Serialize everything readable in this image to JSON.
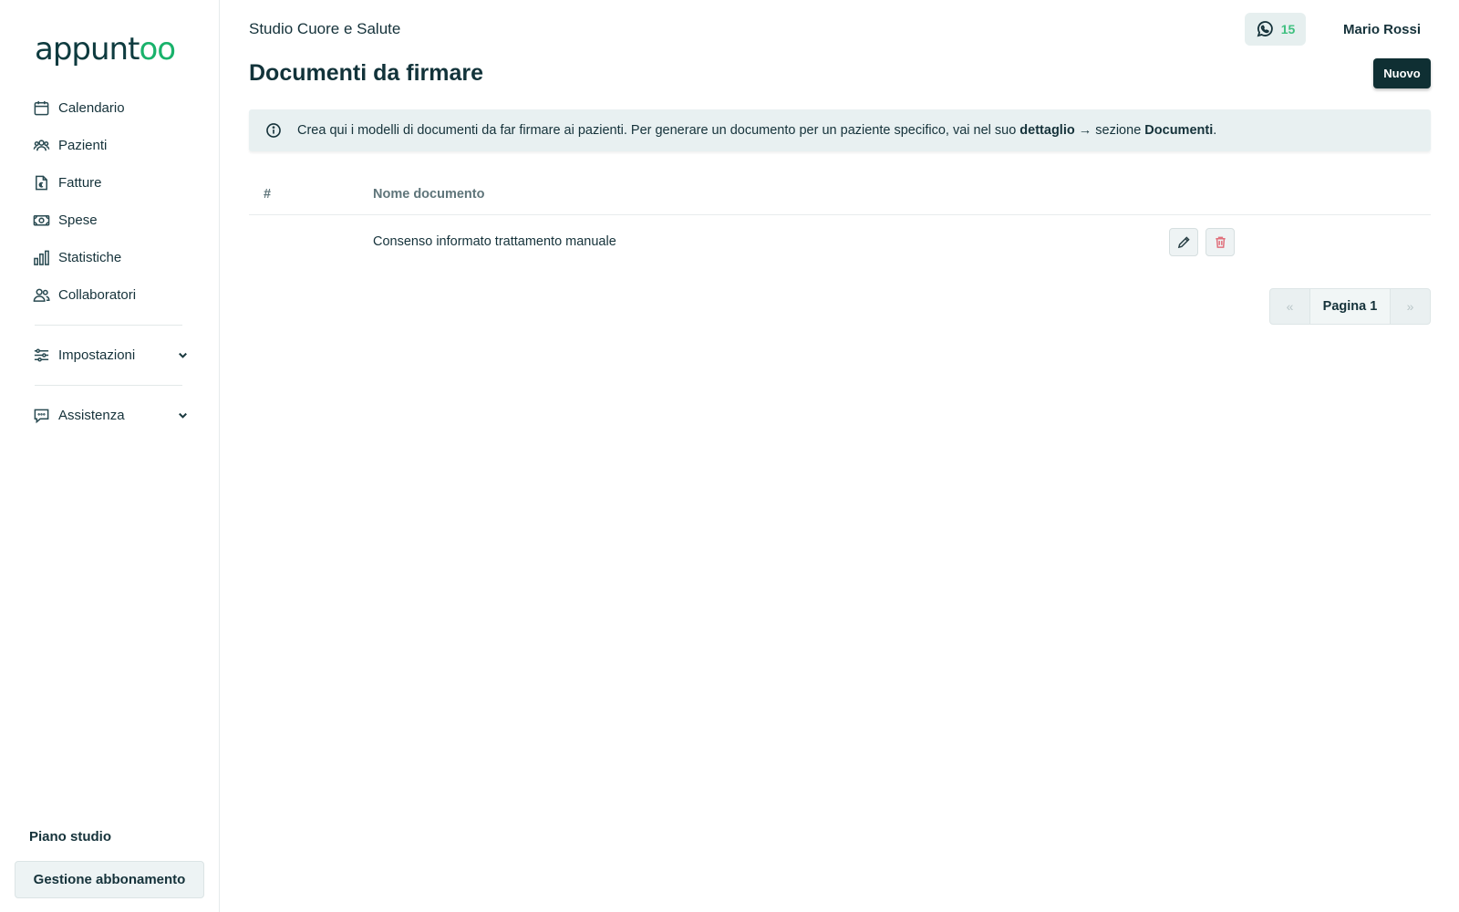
{
  "brand": {
    "logo_prefix": "appunt",
    "logo_suffix": "oo"
  },
  "sidebar": {
    "items": [
      {
        "label": "Calendario",
        "icon": "calendar-icon"
      },
      {
        "label": "Pazienti",
        "icon": "users-icon"
      },
      {
        "label": "Fatture",
        "icon": "invoice-icon"
      },
      {
        "label": "Spese",
        "icon": "banknote-icon"
      },
      {
        "label": "Statistiche",
        "icon": "bar-chart-icon"
      },
      {
        "label": "Collaboratori",
        "icon": "collaborators-icon"
      }
    ],
    "settings": {
      "label": "Impostazioni",
      "icon": "sliders-icon"
    },
    "support": {
      "label": "Assistenza",
      "icon": "chat-icon"
    },
    "plan_title": "Piano studio",
    "plan_button": "Gestione abbonamento"
  },
  "header": {
    "studio_name": "Studio Cuore e Salute",
    "whatsapp_count": "15",
    "user_name": "Mario Rossi"
  },
  "page": {
    "title": "Documenti da firmare",
    "new_button": "Nuovo"
  },
  "info_banner": {
    "text_before": "Crea qui i modelli di documenti da far firmare ai pazienti. Per generare un documento per un paziente specifico, vai nel suo ",
    "bold_1": "dettaglio",
    "text_middle": " → sezione ",
    "bold_2": "Documenti",
    "text_after": "."
  },
  "table": {
    "columns": [
      "#",
      "Nome documento"
    ],
    "rows": [
      {
        "num": "",
        "name": "Consenso informato trattamento manuale"
      }
    ]
  },
  "pagination": {
    "prev": "«",
    "label": "Pagina 1",
    "next": "»"
  },
  "colors": {
    "primary_dark": "#0f2f33",
    "accent_green": "#19b26b",
    "info_bg": "#e8f0f1",
    "delete_red": "#e0707c"
  }
}
